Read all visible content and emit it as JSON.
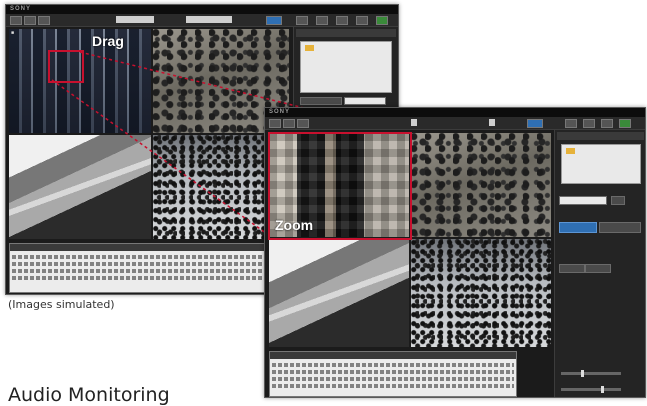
{
  "brand": "SONY",
  "labels": {
    "drag": "Drag",
    "zoom": "Zoom"
  },
  "caption": "(Images simulated)",
  "heading": "Audio Monitoring",
  "colors": {
    "highlight": "#c8102e",
    "window_bg": "#1b1b1b",
    "folder": "#e6b23a",
    "accent_button": "#2f6fb3"
  },
  "icons": [
    "folder-icon",
    "camera-icon"
  ]
}
